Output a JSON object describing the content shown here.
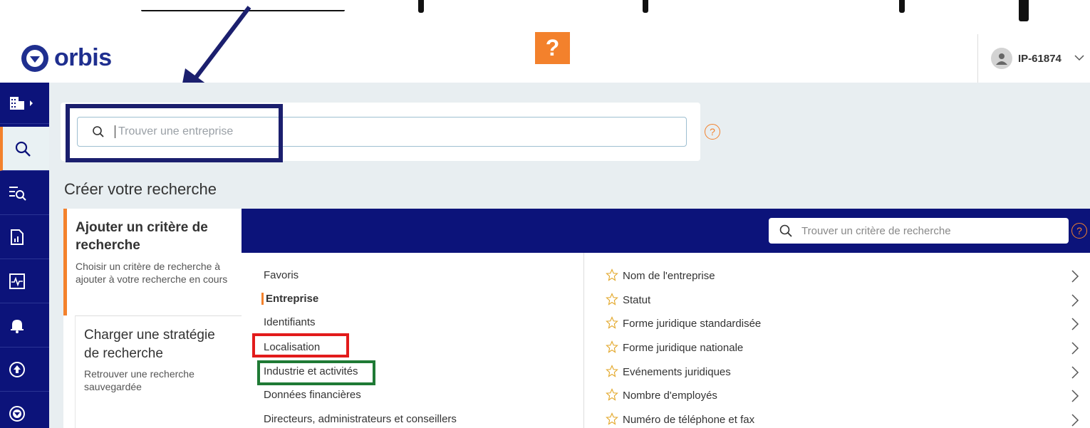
{
  "app": {
    "logo_text": "orbis",
    "help_label": "?"
  },
  "user": {
    "name": "IP-61874"
  },
  "company_search": {
    "placeholder": "Trouver une entreprise",
    "help": "?"
  },
  "section_title": "Créer votre recherche",
  "panel_options": [
    {
      "title": "Ajouter un critère de recherche",
      "desc": "Choisir un critère de recherche à ajouter à votre recherche en cours"
    },
    {
      "title": "Charger une stratégie de recherche",
      "desc": "Retrouver une recherche sauvegardée"
    }
  ],
  "criteria_search": {
    "placeholder": "Trouver un critère de recherche",
    "help": "?"
  },
  "categories": [
    "Favoris",
    "Entreprise",
    "Identifiants",
    "Localisation",
    "Industrie et activités",
    "Données financières",
    "Directeurs, administrateurs et conseillers"
  ],
  "active_category": "Entreprise",
  "criteria": [
    "Nom de l'entreprise",
    "Statut",
    "Forme juridique standardisée",
    "Forme juridique nationale",
    "Evénements juridiques",
    "Nombre d'employés",
    "Numéro de téléphone et fax"
  ],
  "sidebar": {
    "icons": [
      "companies-icon",
      "search-icon",
      "list-search-icon",
      "report-icon",
      "monitor-icon",
      "bell-icon",
      "upload-icon",
      "orbis-icon"
    ],
    "active": "search-icon"
  },
  "colors": {
    "navy": "#0c137a",
    "orange": "#f3812c",
    "annotation_navy": "#1b1f6e",
    "annotation_red": "#e21b1b",
    "annotation_green": "#1f7a35"
  }
}
